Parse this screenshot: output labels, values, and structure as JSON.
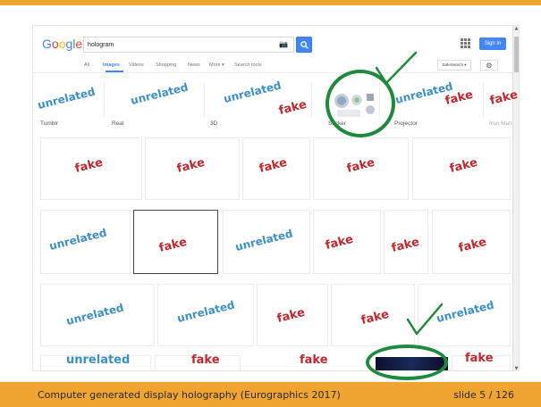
{
  "footer": {
    "title": "Computer generated display holography (Eurographics 2017)",
    "slide": "slide 5 / 126"
  },
  "browser": {
    "logo": [
      "G",
      "o",
      "o",
      "g",
      "l",
      "e"
    ],
    "search_query": "hologram",
    "signin": "Sign in",
    "safesearch": "SafeSearch ▾",
    "tabs": [
      "All",
      "Images",
      "Videos",
      "Shopping",
      "News",
      "More ▾",
      "Search tools"
    ],
    "active_tab": "Images",
    "chips": [
      "Tumblr",
      "Real",
      "3D",
      "Sticker",
      "Projector",
      "Iron Man"
    ]
  },
  "annotations": {
    "unrelated": "unrelated",
    "fake": "fake"
  },
  "colors": {
    "accent_orange": "#f0a531",
    "google_blue": "#4285f4",
    "unrelated_blue": "#3a8fc6",
    "fake_red": "#c0282f",
    "highlight_green": "#1f8a3c"
  }
}
